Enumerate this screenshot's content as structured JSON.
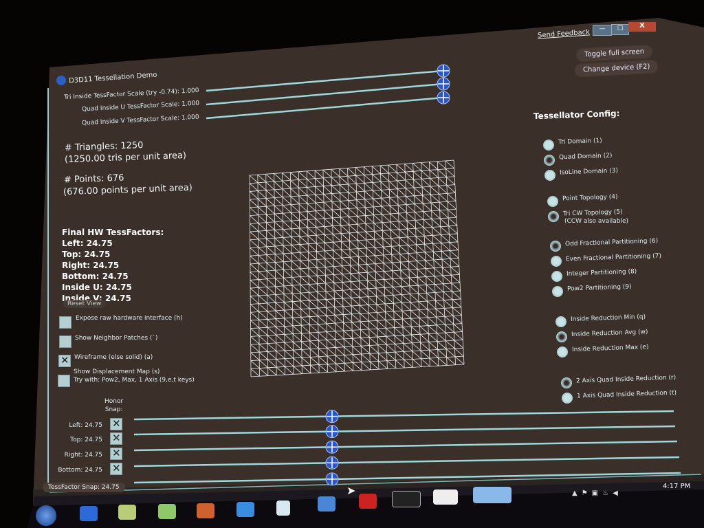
{
  "window": {
    "title": "D3D11 Tessellation Demo",
    "send_feedback": "Send Feedback",
    "minimize": "—",
    "maximize": "□",
    "close": "X"
  },
  "buttons": {
    "toggle_full_screen": "Toggle full screen",
    "change_device": "Change device (F2)",
    "reset_view": "Reset View"
  },
  "top_sliders": [
    {
      "label": "Tri Inside TessFactor Scale (try -0.74): 1.000",
      "value": 1.0
    },
    {
      "label": "Quad Inside U TessFactor Scale: 1.000",
      "value": 1.0
    },
    {
      "label": "Quad Inside V TessFactor Scale: 1.000",
      "value": 1.0
    }
  ],
  "stats": {
    "triangles": "# Triangles: 1250",
    "tris_per_area": "(1250.00 tris per unit area)",
    "points": "# Points: 676",
    "points_per_area": "(676.00 points per unit area)"
  },
  "final_factors": {
    "title": "Final HW TessFactors:",
    "lines": [
      "Left: 24.75",
      "Top: 24.75",
      "Right: 24.75",
      "Bottom: 24.75",
      "Inside U: 24.75",
      "Inside V: 24.75"
    ]
  },
  "checkboxes": [
    {
      "label": "Expose raw hardware interface (h)",
      "checked": false
    },
    {
      "label": "Show Neighbor Patches (`)",
      "checked": false
    },
    {
      "label": "Wireframe (else solid) (a)",
      "checked": true
    },
    {
      "label": "Show Displacement Map (s)",
      "sub": "Try with: Pow2, Max, 1 Axis (9,e,t keys)",
      "checked": false
    }
  ],
  "honor_snap": "Honor\nSnap:",
  "edge_sliders": [
    {
      "label": "Left: 24.75",
      "snap": true
    },
    {
      "label": "Top: 24.75",
      "snap": true
    },
    {
      "label": "Right: 24.75",
      "snap": true
    },
    {
      "label": "Bottom: 24.75",
      "snap": true
    }
  ],
  "tessfactor_snap": "TessFactor Snap: 24.75",
  "config": {
    "title": "Tessellator Config:",
    "groups": [
      [
        {
          "label": "Tri Domain (1)",
          "on": false
        },
        {
          "label": "Quad Domain (2)",
          "on": true
        },
        {
          "label": "IsoLine Domain (3)",
          "on": false
        }
      ],
      [
        {
          "label": "Point Topology (4)",
          "on": false
        },
        {
          "label": "Tri CW Topology (5)",
          "sub": "(CCW also available)",
          "on": true
        }
      ],
      [
        {
          "label": "Odd Fractional Partitioning (6)",
          "on": true
        },
        {
          "label": "Even Fractional Partitioning (7)",
          "on": false
        },
        {
          "label": "Integer Partitioning (8)",
          "on": false
        },
        {
          "label": "Pow2 Partitioning (9)",
          "on": false
        }
      ],
      [
        {
          "label": "Inside Reduction Min (q)",
          "on": false
        },
        {
          "label": "Inside Reduction Avg (w)",
          "on": true
        },
        {
          "label": "Inside Reduction Max (e)",
          "on": false
        }
      ],
      [
        {
          "label": "2 Axis Quad Inside Reduction (r)",
          "on": true
        },
        {
          "label": "1 Axis Quad Inside Reduction (t)",
          "on": false
        }
      ]
    ]
  },
  "mesh": {
    "cells": 25
  },
  "taskbar": {
    "clock": "4:17 PM"
  },
  "colors": {
    "screen": "#3a2f29",
    "accent": "#9fd8dc",
    "thumb": "#2a56c8"
  }
}
